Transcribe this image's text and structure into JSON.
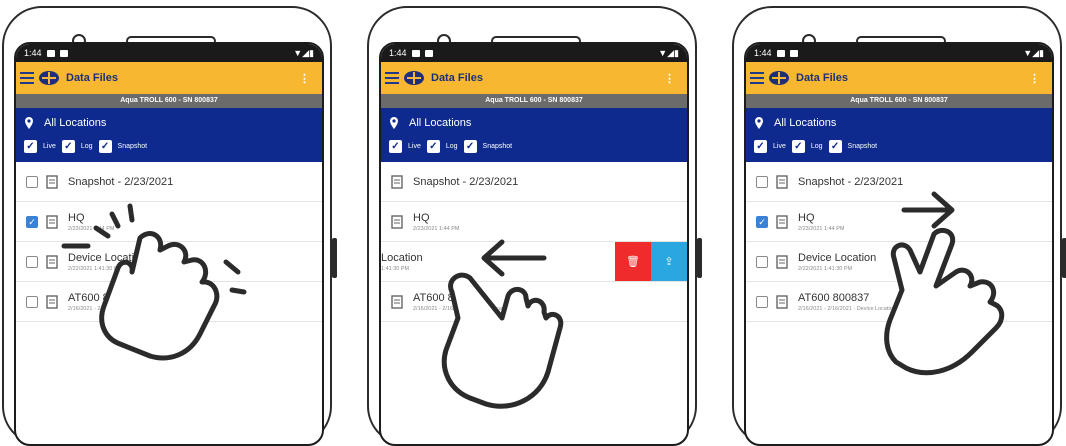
{
  "app": {
    "time": "1:44",
    "title": "Data Files",
    "device_label": "Aqua TROLL 600 - SN 800837",
    "location": "All Locations",
    "filters": [
      "Live",
      "Log",
      "Snapshot"
    ]
  },
  "files": [
    {
      "name": "Snapshot - 2/23/2021",
      "sub": "",
      "checked": false
    },
    {
      "name": "HQ",
      "sub": "2/23/2021 1:44 PM",
      "checked": true
    },
    {
      "name": "Device Location",
      "sub": "2/22/2021 1:41:30 PM",
      "checked": false
    },
    {
      "name": "AT600 800837",
      "sub": "2/16/2021 - 2/16/2021 · Device Location",
      "checked": false
    }
  ],
  "swiped_row": {
    "name": "Location",
    "sub": "1:41:30 PM"
  },
  "gestures": [
    "tap",
    "swipe-left",
    "swipe-right"
  ],
  "colors": {
    "toolbar": "#f7b731",
    "filter_panel": "#0e2a8f",
    "delete": "#ef2b2b",
    "share": "#29a8e0"
  }
}
